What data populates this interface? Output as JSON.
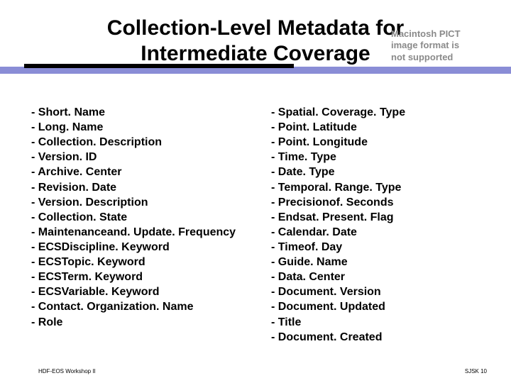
{
  "title": "Collection-Level Metadata for Intermediate Coverage",
  "pict_box": {
    "line1": "Macintosh PICT",
    "line2": "image format is",
    "line3": "not supported"
  },
  "bullet_prefix": "- ",
  "left_items": [
    "Short. Name",
    "Long. Name",
    "Collection. Description",
    "Version. ID",
    "Archive. Center",
    "Revision. Date",
    "Version. Description",
    "Collection. State",
    "Maintenanceand. Update. Frequency",
    "ECSDiscipline. Keyword",
    "ECSTopic. Keyword",
    "ECSTerm. Keyword",
    "ECSVariable. Keyword",
    "Contact. Organization. Name",
    "Role"
  ],
  "right_items": [
    "Spatial. Coverage. Type",
    "Point. Latitude",
    "Point. Longitude",
    "Time. Type",
    "Date. Type",
    "Temporal. Range. Type",
    "Precisionof. Seconds",
    "Endsat. Present. Flag",
    "Calendar. Date",
    "Timeof. Day",
    "Guide. Name",
    "Data. Center",
    "Document. Version",
    "Document. Updated",
    "Title",
    "Document. Created"
  ],
  "footer": {
    "left": "HDF-EOS Workshop II",
    "right": "SJSK 10"
  }
}
